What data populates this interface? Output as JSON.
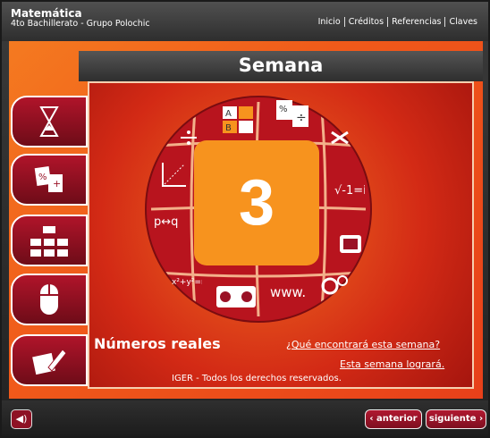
{
  "header": {
    "title": "Matemática",
    "subtitle": "4to Bachillerato - Grupo Polochic",
    "nav": [
      "Inicio",
      "Créditos",
      "Referencias",
      "Claves"
    ]
  },
  "week": {
    "label": "Semana",
    "number": "3",
    "topic": "Números reales",
    "link_what": "¿Qué encontrará esta semana?",
    "link_goals": "Esta semana logrará.",
    "copyright": "IGER - Todos los derechos reservados."
  },
  "sidebar": {
    "items": [
      {
        "name": "hourglass-icon"
      },
      {
        "name": "percentage-cards-icon"
      },
      {
        "name": "org-chart-icon"
      },
      {
        "name": "mouse-icon"
      },
      {
        "name": "pencil-notebook-icon"
      }
    ]
  },
  "footer": {
    "prev_label": "‹ anterior",
    "next_label": "siguiente ›",
    "sound_icon": "speaker-icon"
  },
  "colors": {
    "accent": "#9a1226",
    "orange": "#f47a20",
    "center": "#f7931e"
  }
}
